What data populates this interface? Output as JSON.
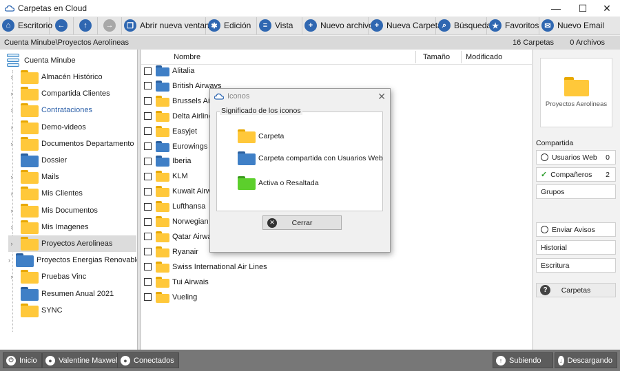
{
  "window": {
    "title": "Carpetas en Cloud",
    "minimize": "—",
    "maximize": "☐",
    "close": "✕"
  },
  "toolbar": {
    "escritorio": "Escritorio",
    "abrir_nueva_ventana": "Abrir nueva ventana",
    "edicion": "Edición",
    "vista": "Vista",
    "nuevo_archivo": "Nuevo archivo",
    "nueva_carpeta": "Nueva Carpeta",
    "busqueda": "Búsqueda",
    "favoritos": "Favoritos",
    "nuevo_email": "Nuevo Email"
  },
  "pathbar": {
    "path": "Cuenta Minube\\Proyectos Aerolineas",
    "folders_count": "16 Carpetas",
    "files_count": "0 Archivos"
  },
  "tree": {
    "root": "Cuenta Minube",
    "items": [
      {
        "label": "Almacén Histórico",
        "color": "yellow",
        "expandable": true
      },
      {
        "label": "Compartida Clientes",
        "color": "yellow",
        "expandable": true
      },
      {
        "label": "Contrataciones",
        "color": "yellow",
        "expandable": true,
        "link": true
      },
      {
        "label": "Demo-videos",
        "color": "yellow",
        "expandable": true
      },
      {
        "label": "Documentos Departamento",
        "color": "yellow",
        "expandable": true
      },
      {
        "label": "Dossier",
        "color": "blue",
        "expandable": false
      },
      {
        "label": "Mails",
        "color": "yellow",
        "expandable": true
      },
      {
        "label": "Mis Clientes",
        "color": "yellow",
        "expandable": true
      },
      {
        "label": "Mis Documentos",
        "color": "yellow",
        "expandable": true
      },
      {
        "label": "Mis Imagenes",
        "color": "yellow",
        "expandable": true
      },
      {
        "label": "Proyectos Aerolineas",
        "color": "yellow",
        "expandable": true,
        "selected": true
      },
      {
        "label": "Proyectos Energias Renovables",
        "color": "blue",
        "expandable": true
      },
      {
        "label": "Pruebas Vinc",
        "color": "yellow",
        "expandable": true
      },
      {
        "label": "Resumen Anual 2021",
        "color": "blue",
        "expandable": false
      },
      {
        "label": "SYNC",
        "color": "yellow",
        "expandable": false
      }
    ]
  },
  "list": {
    "columns": {
      "name": "Nombre",
      "size": "Tamaño",
      "modified": "Modificado"
    },
    "rows": [
      {
        "label": "Alitalia",
        "color": "blue"
      },
      {
        "label": "British Airways",
        "color": "blue"
      },
      {
        "label": "Brussels Airlin",
        "color": "yellow"
      },
      {
        "label": "Delta Airlines",
        "color": "yellow"
      },
      {
        "label": "Easyjet",
        "color": "yellow"
      },
      {
        "label": "Eurowings",
        "color": "blue"
      },
      {
        "label": "Iberia",
        "color": "blue"
      },
      {
        "label": "KLM",
        "color": "yellow"
      },
      {
        "label": "Kuwait Airway",
        "color": "yellow"
      },
      {
        "label": "Lufthansa",
        "color": "yellow"
      },
      {
        "label": "Norwegian Ai",
        "color": "yellow"
      },
      {
        "label": "Qatar Airways",
        "color": "yellow"
      },
      {
        "label": "Ryanair",
        "color": "yellow"
      },
      {
        "label": "Swiss International Air Lines",
        "color": "yellow"
      },
      {
        "label": "Tui Airwais",
        "color": "yellow"
      },
      {
        "label": "Vueling",
        "color": "yellow"
      }
    ]
  },
  "right_panel": {
    "preview_caption": "Proyectos Aerolineas",
    "section": "Compartida",
    "usuarios_web": "Usuarios Web",
    "usuarios_web_count": "0",
    "companeros": "Compañeros",
    "companeros_count": "2",
    "grupos": "Grupos",
    "enviar_avisos": "Enviar Avisos",
    "historial": "Historial",
    "escritura": "Escritura",
    "carpetas": "Carpetas"
  },
  "dialog": {
    "title": "Iconos",
    "group_title": "Significado de los iconos",
    "legend": [
      {
        "label": "Carpeta",
        "color": "yellow"
      },
      {
        "label": "Carpeta compartida con Usuarios Web",
        "color": "blue"
      },
      {
        "label": "Activa o Resaltada",
        "color": "green"
      }
    ],
    "close_button": "Cerrar"
  },
  "statusbar": {
    "inicio": "Inicio",
    "user": "Valentine Maxwell",
    "conectados": "Conectados",
    "subiendo": "Subiendo",
    "descargando": "Descargando"
  },
  "colors": {
    "accent": "#2f67b1",
    "folder_yellow": "#ffc83a",
    "folder_blue": "#3f7fc6",
    "folder_green": "#5ccf2c"
  }
}
